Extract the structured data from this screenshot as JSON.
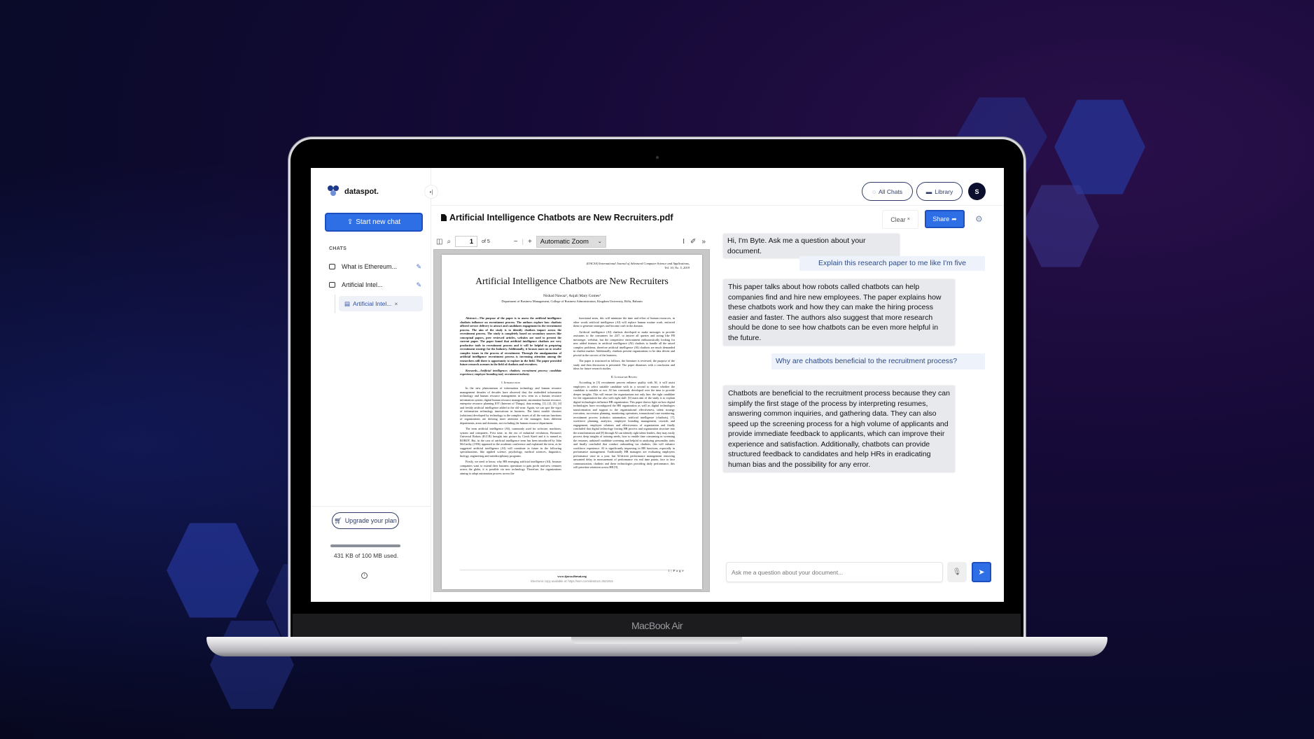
{
  "device": {
    "brand_label": "MacBook Air"
  },
  "app": {
    "logo_text": "dataspot.",
    "collapse_icon": "collapse-sidebar-icon"
  },
  "sidebar": {
    "start_button_label": "Start new chat",
    "chats_heading": "CHATS",
    "chats": [
      {
        "label": "What is Ethereum...",
        "icon": "chat-bubble-icon",
        "action_icon": "edit-icon"
      },
      {
        "label": "Artificial Intel...",
        "icon": "chat-bubble-icon",
        "action_icon": "edit-icon",
        "documents": [
          {
            "label": "Artificial Intel...",
            "icon": "pdf-file-icon",
            "close": "×"
          }
        ]
      }
    ],
    "upgrade_label": "Upgrade your plan",
    "storage": {
      "used_fraction": 0.0043,
      "label": "431 KB of 100 MB used."
    },
    "info_icon": "info-icon"
  },
  "header": {
    "all_chats_label": "All Chats",
    "library_label": "Library",
    "avatar_initial": "S"
  },
  "document": {
    "title": "Artificial Intelligence Chatbots are New Recruiters.pdf",
    "clear_label": "Clear",
    "clear_icon": "×",
    "share_label": "Share"
  },
  "pdf_viewer": {
    "current_page": "1",
    "page_count_label": "of 5",
    "zoom_label": "Automatic Zoom",
    "page": {
      "journal": "(IJACSA) International Journal of Advanced Computer Science and Applications,",
      "journal_vol": "Vol. 10, No. 5, 2019",
      "title": "Artificial Intelligence Chatbots are New Recruiters",
      "authors": "Nishad Nawaz¹, Anjali Mary Gomes²",
      "department": "Department of Business Management, College of Business Administration, Kingdom University, Riffa, Bahrain",
      "abstract": "Abstract—The purpose of the paper is to assess the artificial intelligence chatbots influence on recruitment process. The authors explore how chatbots offered service delivery to attract and candidates engagement in the recruitment process. The aim of the study is to identify chatbots impact across the recruitment process. The study is completely based on secondary sources like conceptual papers, peer reviewed articles, websites are used to present the current paper. The paper found that artificial intelligence chatbots are very productive tools in recruitment process and it will be helpful in preparing recruitment strategy for the Industry. Additionally, it focuses more on to resolve complex issues in the process of recruitment. Through the amalgamation of artificial intelligence recruitment process is increasing attention among the researchers still there is opportunity to explore in the field. The paper provided future research avenues in the field of chatbots and recruiters.",
      "keywords": "Keywords—Artificial intelligence; chatbots; recruitment process; candidate experience; employer branding tool; recruitment industry",
      "intro_heading": "I. Introduction",
      "intro_p1": "In the new phenomenon of information technology and human resource management decades of decades have observed that, the embedded information technology and human resource management in new term as a human resource information system, digital human resource management, automation human resource, enterprise resource planning IOT (Internet of Things), data mining, [1], [2], [3], [4] and freshly artificial intelligence added to the old wine. Again, we can spot the vigor of information technology innovations in business. The latest trouble shooters (solutions) developed by technology to the complex issues of all the various functions of organizations are drawing more attention of the managers from different departments, areas and domains, not excluding the human resource department.",
      "intro_p2": "The term artificial intelligence (AI), commonly used for software, machines, system and computers. First time, in the era of industrial revolution, Rossum's Universal Robots (R.U.R) brought into picture by Czech Karel and it is named as ROBOT. But, in the case of artificial intelligence term has been introduced by John McCarthy (1956) appeared in the academic conference and explained the term, as he suggested artificial intelligence (AI) will constitute in future in the following specializations, like applied science, psychology, medical sciences, linguistics, biology, engineering and interdisciplinary programs.",
      "intro_p3": "Firstly, we need to know, why HR emerging artificial intelligence (AI), because companies want to extend their business operations to gain profit and new ventures across the globe, it is possible via new technology. Therefore, the organizations aiming to adopt automation process across the",
      "right_p1": "functional areas, this will minimize the time and effort of human resources, in other words artificial intelligence (AI) will replace human routine work, enforced them to generate strategies and become craft in the domain.",
      "right_p2": "Artificial intelligence (AI) chatbots developed to make messages to provide assistants to the consumers for 24/7, to answer all queries and acting like FB messenger, webchat, but the competitive environment enthusiastically looking for new added features in artificial intelligence (AI) chatbots to handle all the raised complex problems, therefore artificial intelligence (AI) chatbots are much demanded in chatbot market. Additionally, chatbots present organizations to be data driven and pivotal in the success of the business.",
      "right_p3": "The paper is structured as follows, the literature is reviewed, the purpose of the study and then discussion is presented. The paper dismisses with a conclusion and ideas for future research studies.",
      "lit_heading": "II. Literature Review",
      "lit_p1": "According to [5] recruitment process enhance quality with AI, it will assist employers to select suitable candidate with in a second to ensure whether the candidate is suitable or not. AI has constantly developed over the time to provide deeper insights. This will ensure the organizations not only hire, the right candidate for the organization but also with right skill. [6] main aim of the study is to explain digital technologies influence HR organization. This paper throws light on how digital technologies have reconfigured the HR organization as well as digital technologies transformation and support to the organizational effectiveness, talent strategy execution, succession planning, monitoring operations, transactional case monitoring, recruitment process (robotics automation, artificial intelligence (chatbots), [7], workforce planning, analytics, employee branding management, rewards and engagement, employee relations and effectiveness of organization and finally concluded that digital technology forcing HR process and organization structure into the transformation and [8] through AI can identify right talent leaders, they may easily process deep insights of training needs, how to enable time consuming in screening the resumes, unbiased candidate screening and helpful in analyzing personality traits and finally concluded that conduct onboarding via chatbots, this will enhance workforce experience. AI is significantly improving in HR functions, especially in performance management. Traditionally HR managers are evaluating employees performance once in a year, but AI-driven performance management removing unwanted delay in measurement of performance via real time points, face to face communication, chatbots and these technologies providing daily performance, this will prioritize retention across HR [9].",
      "footer_site": "www.ijacsa.thesai.org",
      "footer_url": "Electronic copy available at: https://ssrn.com/abstract=3521915",
      "page_label": "1 | P a g e"
    }
  },
  "chat": {
    "messages": [
      {
        "role": "assistant",
        "text": "Hi, I'm Byte. Ask me a question about your document."
      },
      {
        "role": "user",
        "text": "Explain this research paper to me like I'm five"
      },
      {
        "role": "assistant",
        "text": "This paper talks about how robots called chatbots can help companies find and hire new employees. The paper explains how these chatbots work and how they can make the hiring process easier and faster. The authors also suggest that more research should be done to see how chatbots can be even more helpful in the future."
      },
      {
        "role": "user",
        "text": "Why are chatbots beneficial to the recruitment process?"
      },
      {
        "role": "assistant",
        "text": "Chatbots are beneficial to the recruitment process because they can simplify the first stage of the process by interpreting resumes, answering common inquiries, and gathering data. They can also speed up the screening process for a high volume of applicants and provide immediate feedback to applicants, which can improve their experience and satisfaction. Additionally, chatbots can provide structured feedback to candidates and help HRs in eradicating human bias and the possibility for any error."
      }
    ],
    "input_placeholder": "Ask me a question about your document...",
    "input_value": ""
  },
  "colors": {
    "accent": "#2f6fe6",
    "navy": "#2e3b66",
    "avatar_bg": "#0d0f2e"
  }
}
